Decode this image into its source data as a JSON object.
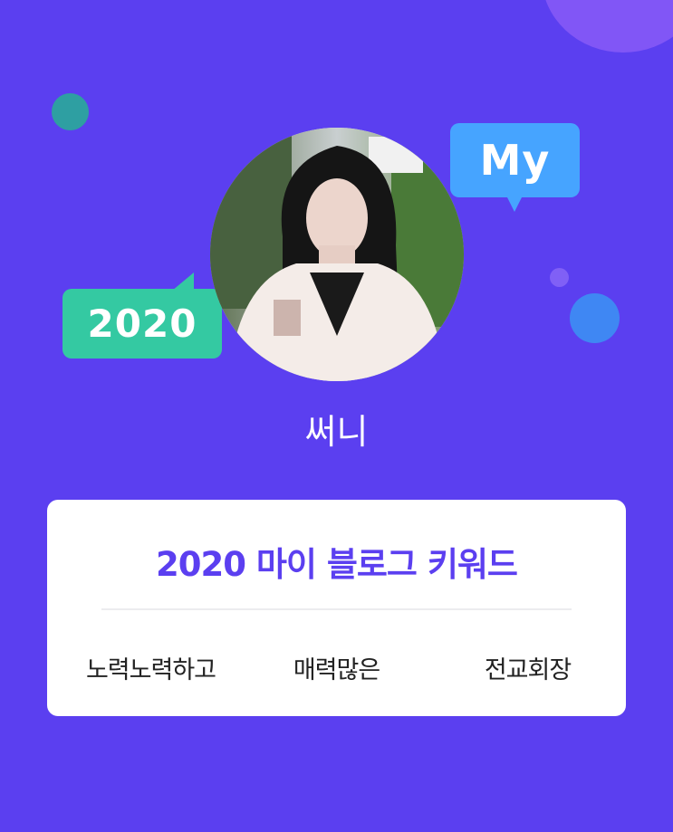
{
  "profile": {
    "nickname": "써니"
  },
  "bubbles": {
    "my": "My",
    "year": "2020"
  },
  "card": {
    "title": "2020 마이 블로그 키워드",
    "keywords": [
      "노력노력하고",
      "매력많은",
      "전교회장"
    ]
  },
  "colors": {
    "background": "#5b3ff0",
    "accent_text": "#5b3ff0",
    "bubble_my": "#46a4ff",
    "bubble_year": "#34c9a2",
    "card": "#ffffff"
  }
}
